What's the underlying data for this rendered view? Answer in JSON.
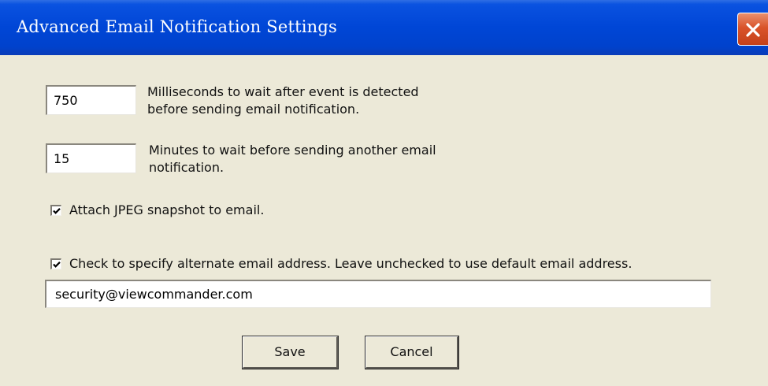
{
  "window": {
    "title": "Advanced Email Notification Settings"
  },
  "delay": {
    "value": "750",
    "label_line1": "Milliseconds to wait after event is detected",
    "label_line2": "before sending email notification."
  },
  "resend": {
    "value": "15",
    "label_line1": "Minutes to wait before sending another email",
    "label_line2": "notification."
  },
  "attach_jpeg": {
    "checked": true,
    "label": "Attach JPEG snapshot to email."
  },
  "alternate_email": {
    "checked": true,
    "label": "Check to specify alternate email address. Leave unchecked to use default email address.",
    "value": "security@viewcommander.com"
  },
  "buttons": {
    "save": "Save",
    "cancel": "Cancel"
  },
  "colors": {
    "titlebar": "#0046d6",
    "close_button": "#d9532a",
    "dialog_background": "#ece9d8"
  }
}
